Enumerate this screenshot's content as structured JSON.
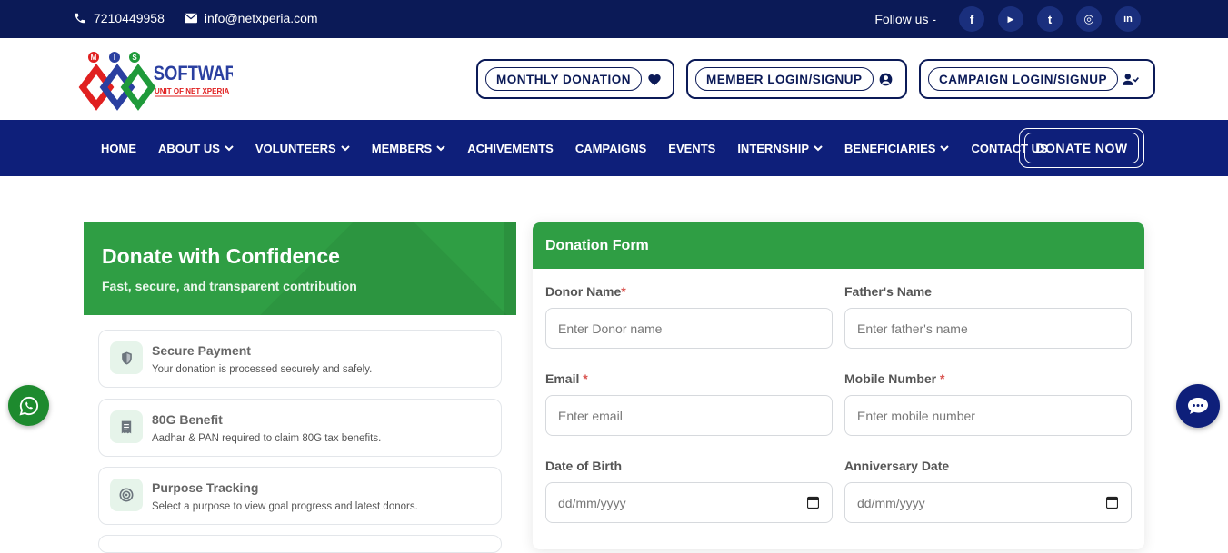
{
  "topbar": {
    "phone": "7210449958",
    "email": "info@netxperia.com",
    "follow_label": "Follow us -",
    "social": [
      {
        "icon": "facebook-icon",
        "glyph": "f"
      },
      {
        "icon": "youtube-icon",
        "glyph": "▶"
      },
      {
        "icon": "twitter-icon",
        "glyph": "t"
      },
      {
        "icon": "instagram-icon",
        "glyph": "◎"
      },
      {
        "icon": "linkedin-icon",
        "glyph": "in"
      }
    ]
  },
  "logo": {
    "letters": [
      "M",
      "I",
      "S"
    ],
    "brand": "SOFTWARE",
    "tagline": "UNIT OF NET XPERIA"
  },
  "header_buttons": {
    "monthly": "MONTHLY DONATION",
    "member": "MEMBER LOGIN/SIGNUP",
    "campaign": "CAMPAIGN LOGIN/SIGNUP"
  },
  "nav": {
    "items": [
      "HOME",
      "ABOUT US",
      "VOLUNTEERS",
      "MEMBERS",
      "ACHIVEMENTS",
      "CAMPAIGNS",
      "EVENTS",
      "INTERNSHIP",
      "BENEFICIARIES",
      "CONTACT US"
    ],
    "donate": "DONATE NOW"
  },
  "hero": {
    "title": "Donate with Confidence",
    "subtitle": "Fast, secure, and transparent contribution"
  },
  "features": [
    {
      "title": "Secure Payment",
      "desc": "Your donation is processed securely and safely.",
      "icon": "shield-icon"
    },
    {
      "title": "80G Benefit",
      "desc": "Aadhar & PAN required to claim 80G tax benefits.",
      "icon": "receipt-icon"
    },
    {
      "title": "Purpose Tracking",
      "desc": "Select a purpose to view goal progress and latest donors.",
      "icon": "target-icon"
    }
  ],
  "form": {
    "title": "Donation Form",
    "donor_label": "Donor Name",
    "donor_placeholder": "Enter Donor name",
    "father_label": "Father's Name",
    "father_placeholder": "Enter father's name",
    "email_label": "Email",
    "email_placeholder": "Enter email",
    "mobile_label": "Mobile Number",
    "mobile_placeholder": "Enter mobile number",
    "dob_label": "Date of Birth",
    "dob_placeholder": "dd/mm/yyyy",
    "anniv_label": "Anniversary Date",
    "anniv_placeholder": "dd/mm/yyyy",
    "required_mark": "*"
  },
  "colors": {
    "navy": "#0b1a57",
    "nav": "#0e1f7a",
    "green": "#2f9e44",
    "required": "#d9534f"
  }
}
